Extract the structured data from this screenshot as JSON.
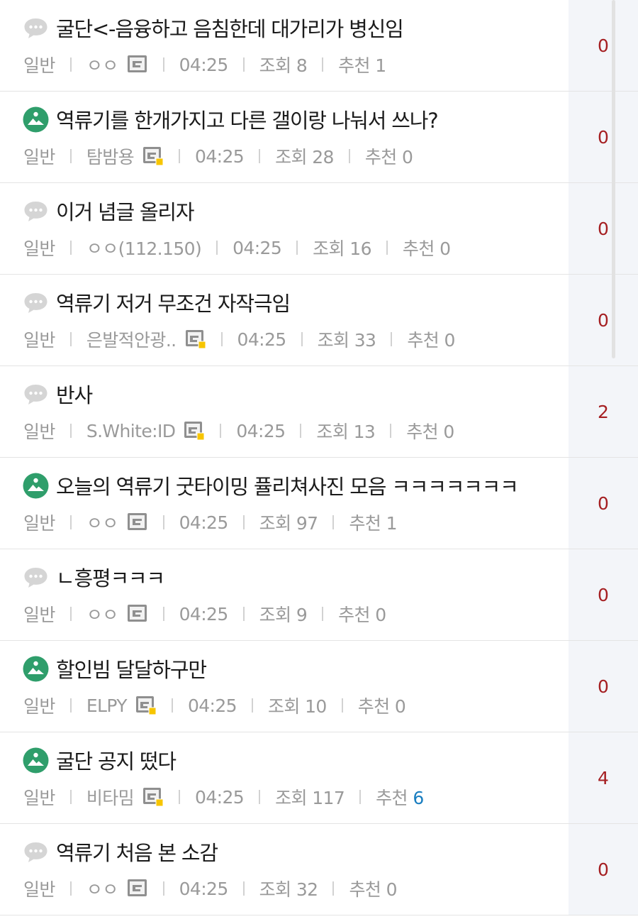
{
  "posts": [
    {
      "title": "굴단<-음융하고 음침한데 대가리가 병신임",
      "icon": "speech-bubble-icon",
      "category": "일반",
      "author": "ㅇㅇ",
      "badge": "fixed-nick-badge",
      "time": "04:25",
      "views": "조회 8",
      "rec_label": "추천",
      "rec_value": "1",
      "comments": "0"
    },
    {
      "title": "역류기를 한개가지고 다른 갤이랑 나눠서 쓰나?",
      "icon": "image-post-icon",
      "category": "일반",
      "author": "탐밤용",
      "badge": "member-badge",
      "time": "04:25",
      "views": "조회 28",
      "rec_label": "추천",
      "rec_value": "0",
      "comments": "0"
    },
    {
      "title": "이거 념글 올리자",
      "icon": "speech-bubble-icon",
      "category": "일반",
      "author": "ㅇㅇ(112.150)",
      "badge": "",
      "time": "04:25",
      "views": "조회 16",
      "rec_label": "추천",
      "rec_value": "0",
      "comments": "0"
    },
    {
      "title": "역류기 저거 무조건 자작극임",
      "icon": "speech-bubble-icon",
      "category": "일반",
      "author": "은발적안광..",
      "badge": "member-badge",
      "time": "04:25",
      "views": "조회 33",
      "rec_label": "추천",
      "rec_value": "0",
      "comments": "0"
    },
    {
      "title": "반사",
      "icon": "speech-bubble-icon",
      "category": "일반",
      "author": "S.White:ID",
      "badge": "member-badge",
      "time": "04:25",
      "views": "조회 13",
      "rec_label": "추천",
      "rec_value": "0",
      "comments": "2"
    },
    {
      "title": "오늘의 역류기 굿타이밍 퓰리쳐사진 모음 ㅋㅋㅋㅋㅋㅋㅋ",
      "icon": "image-post-icon",
      "category": "일반",
      "author": "ㅇㅇ",
      "badge": "fixed-nick-badge",
      "time": "04:25",
      "views": "조회 97",
      "rec_label": "추천",
      "rec_value": "1",
      "comments": "0"
    },
    {
      "title": "ㄴ흥평ㅋㅋㅋ",
      "icon": "speech-bubble-icon",
      "category": "일반",
      "author": "ㅇㅇ",
      "badge": "fixed-nick-badge",
      "time": "04:25",
      "views": "조회 9",
      "rec_label": "추천",
      "rec_value": "0",
      "comments": "0"
    },
    {
      "title": "할인빔 달달하구만",
      "icon": "image-post-icon",
      "category": "일반",
      "author": "ELPY",
      "badge": "member-badge",
      "time": "04:25",
      "views": "조회 10",
      "rec_label": "추천",
      "rec_value": "0",
      "comments": "0"
    },
    {
      "title": "굴단 공지 떴다",
      "icon": "image-post-icon",
      "category": "일반",
      "author": "비타밈",
      "badge": "member-badge",
      "time": "04:25",
      "views": "조회 117",
      "rec_label": "추천",
      "rec_value": "6",
      "rec_highlight": true,
      "comments": "4"
    },
    {
      "title": "역류기 처음 본 소감",
      "icon": "speech-bubble-icon",
      "category": "일반",
      "author": "ㅇㅇ",
      "badge": "fixed-nick-badge",
      "time": "04:25",
      "views": "조회 32",
      "rec_label": "추천",
      "rec_value": "0",
      "comments": "0"
    }
  ],
  "colors": {
    "title": "#1b1b1b",
    "meta": "#9a9a9a",
    "comment_count": "#a51f22",
    "image_icon": "#2f9e6b",
    "speech_icon": "#d5d5d5",
    "rec_highlight": "#1a7ec0",
    "side_panel": "#f3f5f9"
  }
}
